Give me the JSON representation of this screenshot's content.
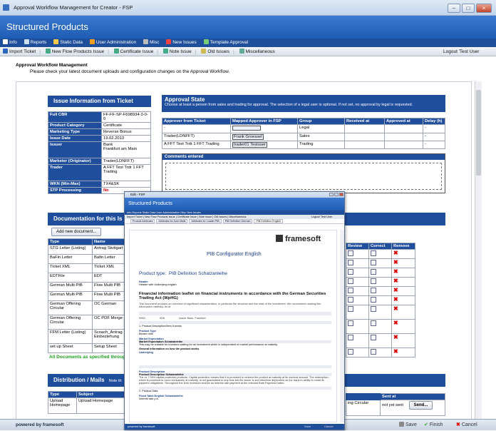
{
  "window": {
    "title": "Approval Workflow Management for Creator - FSP",
    "banner": "Structured Products"
  },
  "menu1": [
    "Info",
    "Reports",
    "Static Data",
    "User Administration",
    "Misc",
    "New Issues",
    "Template Approval"
  ],
  "menu2": [
    "Import Ticket",
    "New Flow Products Issue",
    "Certificate Issue",
    "Note Issue",
    "Old Issues",
    "Miscellaneous"
  ],
  "logout": "Logout 'Test User",
  "page": {
    "title": "Approval Workflow Management",
    "subtitle": "Please check your latest document uploads and configuration changes on the Approval Workflow."
  },
  "issue": {
    "header": "Issue Information from Ticket",
    "rows": [
      {
        "label": "Full CBR",
        "value": "FF-FF-SP-F698934-3-0-0"
      },
      {
        "label": "Product Category",
        "value": "Certificate"
      },
      {
        "label": "Marketing Type",
        "value": "Reverse Bonus"
      },
      {
        "label": "Issue Date",
        "value": "19.02.2013"
      },
      {
        "label": "Issuer",
        "value": "Bank\nFrankfurt am Main"
      },
      {
        "label": "Marketer (Originator)",
        "value": "Trader(LDNFFT)"
      },
      {
        "label": "Trader",
        "value": "A FFT Test Trdr 1 FFT Trading"
      },
      {
        "label": "WKN (Min-Max)",
        "value": "TX4&SK"
      },
      {
        "label": "STP Processing",
        "value": "No"
      }
    ]
  },
  "approval": {
    "header": "Approval State",
    "note": "Choose at least a person from sales and trading for approval. The selection of a legal user is optional. If not set, no approval by legal is requested.",
    "columns": [
      "Approver from Ticket",
      "Mapped Approver in FSP",
      "Group",
      "Received at",
      "Approved at",
      "Delay (h)"
    ],
    "rows": [
      {
        "from": "-",
        "mapped": "",
        "group": "Legal",
        "received": "",
        "approved": "",
        "delay": "-"
      },
      {
        "from": "Trader(LDNFFT)",
        "mapped": "Frank Groessel",
        "group": "Sales",
        "received": "",
        "approved": "",
        "delay": "-"
      },
      {
        "from": "A FFT Test Trdr 1 FFT Trading",
        "mapped": "trader01 Testuser",
        "group": "Trading",
        "received": "",
        "approved": "",
        "delay": "-"
      }
    ],
    "comments_header": "Comments entered"
  },
  "documentation": {
    "header": "Documentation for this Is",
    "add_button": "Add new document...",
    "columns": [
      "Type",
      "Name"
    ],
    "right_columns": [
      "Review",
      "Correct",
      "Remove"
    ],
    "rows": [
      {
        "type": "STG Letter (Listing)",
        "name": "Antrag Stuttgart"
      },
      {
        "type": "BaFin Letter",
        "name": "Bafin Letter"
      },
      {
        "type": "Ticket XML",
        "name": "Ticket XML"
      },
      {
        "type": "EDTFile",
        "name": "EDT"
      },
      {
        "type": "German Multi PIB",
        "name": "Flow Multi PIB"
      },
      {
        "type": "German Multi PIB",
        "name": "Flow Multi PIB"
      },
      {
        "type": "German Offering Circular",
        "name": "OC German"
      },
      {
        "type": "German Offering Circular",
        "name": "OC PDF Merge"
      },
      {
        "type": "FFM Letter (Listing)",
        "name": "Scoach_Antrag Einbeziehung"
      },
      {
        "type": "set up Sheet",
        "name": "Setup Sheet"
      }
    ],
    "status": "All Documents as specified through"
  },
  "distribution": {
    "header": "Distribution / Mails",
    "header_note": "Note th",
    "columns": [
      "Type",
      "Subject",
      "Sent at"
    ],
    "row": {
      "type": "Upload Homepage",
      "subject": "Upload Homepage",
      "tail": "ing Circular",
      "sent": "not yet sent",
      "button": "Send..."
    }
  },
  "footer": {
    "powered": "powered by framesoft",
    "save": "Save",
    "finish": "Finish",
    "cancel": "Cancel"
  },
  "popup": {
    "title": "Edit - FSP",
    "banner": "Structured Products",
    "menu1": "Info  Reports  Static Data  User Administration  Misc  New Issues",
    "menu2": "Import Ticket | New Flow Products Issue | Certificate Issue | Note Issue | Old Issues | Miscellaneous",
    "logout": "Logout 'Test User",
    "tabs": [
      "Product Attributes",
      "Attributes for Auto Mails",
      "Attributes for Loader PIB",
      "PIB Definition German",
      "PIB Definition English"
    ],
    "logo": "framesoft",
    "doc_title": "PIB Configurator English",
    "product_type_label": "Product type:",
    "product_type_value": "PIB Definition Schatzanleihe",
    "header_label": "Header",
    "header_value": "Header with Underlying english",
    "leaflet_title": "Financial information leaflet on financial instruments in accordance with the German Securities Trading Act (WpHG)",
    "leaflet_text": "This document provides an overview of significant characteristics, in particular the structure and the risks of the investment. We recommend reading this information carefully. As at",
    "wkn_row": [
      "WKN",
      "ISIN",
      "Issuer Bank, Frankfurt"
    ],
    "section1": "1. Product Description/Item it works",
    "product_type": "Product Type",
    "product_type_text": "Bearer note",
    "market_expectation": "Market Expectation",
    "market_expectation_value": "Market Expectation Schatzanleihe",
    "market_text": "This may be suitable for investors waiting for an investment which is independent of market performance at maturity.",
    "general_info": "General information on how the product works",
    "underlying": "Underlying",
    "product_desc": "Product Description",
    "product_desc_value": "Product Description Schatzanleihe",
    "product_desc_text": "The xx 7.00% capital-protected products. Capital protection means that it is promised to redeem the product at maturity at its nominal amount. The redemption, which is promised to occur exclusively at maturity, is not guaranteed to any time but the issuer is and therefore dependent on the Issuer's ability to credit its payment obligations. Throughout the term investors receive an interest rate payment at the relevant Rate Payment Dates.",
    "section2": "2. Product Data",
    "fixed_table": "Fixed Table English Schatzanleihe",
    "interest": "Interest rate p.a.",
    "foot_left": "powered by framesoft",
    "foot_save": "Save",
    "foot_cancel": "Cancel"
  }
}
